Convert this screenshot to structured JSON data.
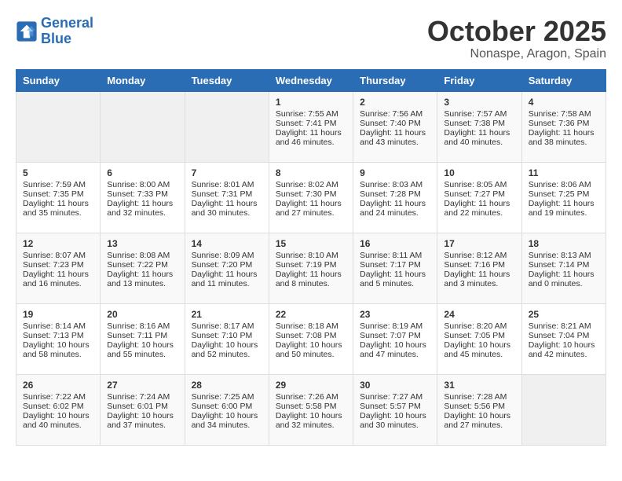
{
  "header": {
    "logo_line1": "General",
    "logo_line2": "Blue",
    "month": "October 2025",
    "location": "Nonaspe, Aragon, Spain"
  },
  "days_of_week": [
    "Sunday",
    "Monday",
    "Tuesday",
    "Wednesday",
    "Thursday",
    "Friday",
    "Saturday"
  ],
  "weeks": [
    [
      {
        "day": "",
        "info": ""
      },
      {
        "day": "",
        "info": ""
      },
      {
        "day": "",
        "info": ""
      },
      {
        "day": "1",
        "info": "Sunrise: 7:55 AM\nSunset: 7:41 PM\nDaylight: 11 hours\nand 46 minutes."
      },
      {
        "day": "2",
        "info": "Sunrise: 7:56 AM\nSunset: 7:40 PM\nDaylight: 11 hours\nand 43 minutes."
      },
      {
        "day": "3",
        "info": "Sunrise: 7:57 AM\nSunset: 7:38 PM\nDaylight: 11 hours\nand 40 minutes."
      },
      {
        "day": "4",
        "info": "Sunrise: 7:58 AM\nSunset: 7:36 PM\nDaylight: 11 hours\nand 38 minutes."
      }
    ],
    [
      {
        "day": "5",
        "info": "Sunrise: 7:59 AM\nSunset: 7:35 PM\nDaylight: 11 hours\nand 35 minutes."
      },
      {
        "day": "6",
        "info": "Sunrise: 8:00 AM\nSunset: 7:33 PM\nDaylight: 11 hours\nand 32 minutes."
      },
      {
        "day": "7",
        "info": "Sunrise: 8:01 AM\nSunset: 7:31 PM\nDaylight: 11 hours\nand 30 minutes."
      },
      {
        "day": "8",
        "info": "Sunrise: 8:02 AM\nSunset: 7:30 PM\nDaylight: 11 hours\nand 27 minutes."
      },
      {
        "day": "9",
        "info": "Sunrise: 8:03 AM\nSunset: 7:28 PM\nDaylight: 11 hours\nand 24 minutes."
      },
      {
        "day": "10",
        "info": "Sunrise: 8:05 AM\nSunset: 7:27 PM\nDaylight: 11 hours\nand 22 minutes."
      },
      {
        "day": "11",
        "info": "Sunrise: 8:06 AM\nSunset: 7:25 PM\nDaylight: 11 hours\nand 19 minutes."
      }
    ],
    [
      {
        "day": "12",
        "info": "Sunrise: 8:07 AM\nSunset: 7:23 PM\nDaylight: 11 hours\nand 16 minutes."
      },
      {
        "day": "13",
        "info": "Sunrise: 8:08 AM\nSunset: 7:22 PM\nDaylight: 11 hours\nand 13 minutes."
      },
      {
        "day": "14",
        "info": "Sunrise: 8:09 AM\nSunset: 7:20 PM\nDaylight: 11 hours\nand 11 minutes."
      },
      {
        "day": "15",
        "info": "Sunrise: 8:10 AM\nSunset: 7:19 PM\nDaylight: 11 hours\nand 8 minutes."
      },
      {
        "day": "16",
        "info": "Sunrise: 8:11 AM\nSunset: 7:17 PM\nDaylight: 11 hours\nand 5 minutes."
      },
      {
        "day": "17",
        "info": "Sunrise: 8:12 AM\nSunset: 7:16 PM\nDaylight: 11 hours\nand 3 minutes."
      },
      {
        "day": "18",
        "info": "Sunrise: 8:13 AM\nSunset: 7:14 PM\nDaylight: 11 hours\nand 0 minutes."
      }
    ],
    [
      {
        "day": "19",
        "info": "Sunrise: 8:14 AM\nSunset: 7:13 PM\nDaylight: 10 hours\nand 58 minutes."
      },
      {
        "day": "20",
        "info": "Sunrise: 8:16 AM\nSunset: 7:11 PM\nDaylight: 10 hours\nand 55 minutes."
      },
      {
        "day": "21",
        "info": "Sunrise: 8:17 AM\nSunset: 7:10 PM\nDaylight: 10 hours\nand 52 minutes."
      },
      {
        "day": "22",
        "info": "Sunrise: 8:18 AM\nSunset: 7:08 PM\nDaylight: 10 hours\nand 50 minutes."
      },
      {
        "day": "23",
        "info": "Sunrise: 8:19 AM\nSunset: 7:07 PM\nDaylight: 10 hours\nand 47 minutes."
      },
      {
        "day": "24",
        "info": "Sunrise: 8:20 AM\nSunset: 7:05 PM\nDaylight: 10 hours\nand 45 minutes."
      },
      {
        "day": "25",
        "info": "Sunrise: 8:21 AM\nSunset: 7:04 PM\nDaylight: 10 hours\nand 42 minutes."
      }
    ],
    [
      {
        "day": "26",
        "info": "Sunrise: 7:22 AM\nSunset: 6:02 PM\nDaylight: 10 hours\nand 40 minutes."
      },
      {
        "day": "27",
        "info": "Sunrise: 7:24 AM\nSunset: 6:01 PM\nDaylight: 10 hours\nand 37 minutes."
      },
      {
        "day": "28",
        "info": "Sunrise: 7:25 AM\nSunset: 6:00 PM\nDaylight: 10 hours\nand 34 minutes."
      },
      {
        "day": "29",
        "info": "Sunrise: 7:26 AM\nSunset: 5:58 PM\nDaylight: 10 hours\nand 32 minutes."
      },
      {
        "day": "30",
        "info": "Sunrise: 7:27 AM\nSunset: 5:57 PM\nDaylight: 10 hours\nand 30 minutes."
      },
      {
        "day": "31",
        "info": "Sunrise: 7:28 AM\nSunset: 5:56 PM\nDaylight: 10 hours\nand 27 minutes."
      },
      {
        "day": "",
        "info": ""
      }
    ]
  ]
}
